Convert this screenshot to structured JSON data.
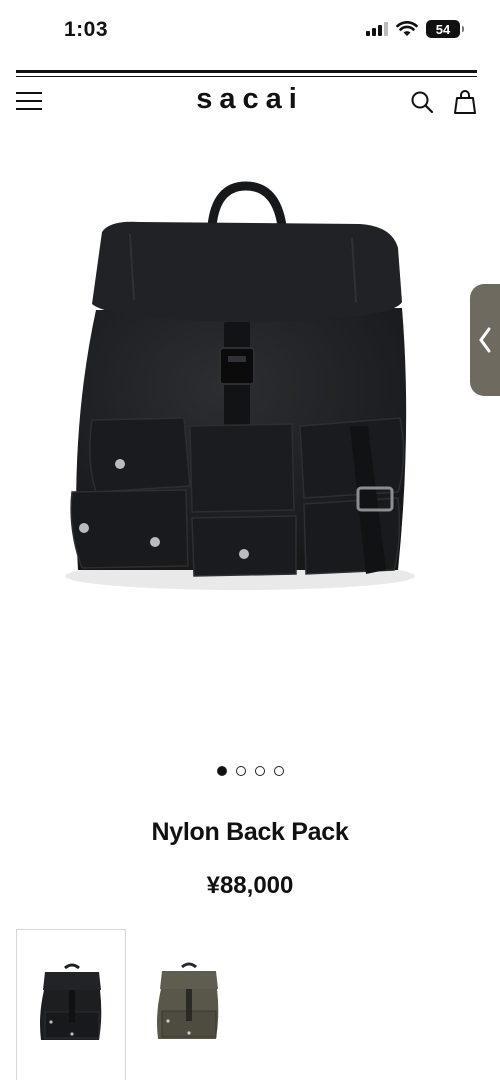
{
  "status": {
    "time": "1:03",
    "battery": "54"
  },
  "header": {
    "brand": "sacai"
  },
  "product": {
    "name": "Nylon Back Pack",
    "price": "¥88,000",
    "image_count": 4,
    "active_image": 1
  },
  "thumbnails": [
    {
      "color": "black",
      "fill": "#1d1e20"
    },
    {
      "color": "khaki",
      "fill": "#59564a"
    }
  ],
  "icons": [
    "menu-icon",
    "search-icon",
    "bag-icon",
    "chevron-left-icon"
  ]
}
